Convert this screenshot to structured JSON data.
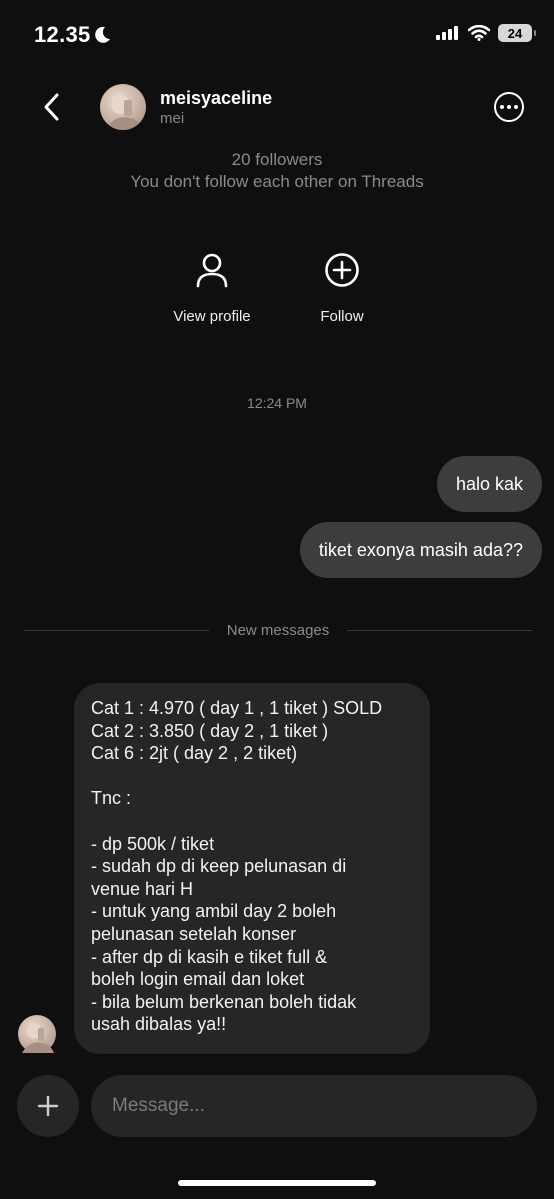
{
  "status_bar": {
    "time": "12.35",
    "battery": "24"
  },
  "header": {
    "username": "meisyaceline",
    "subname": "mei"
  },
  "profile_info": {
    "followers": "20 followers",
    "mutual": "You don't follow each other on Threads"
  },
  "actions": {
    "view_profile": "View profile",
    "follow": "Follow"
  },
  "timestamp": "12:24 PM",
  "outgoing": [
    "halo kak",
    "tiket exonya masih ada??"
  ],
  "divider": "New messages",
  "incoming_lines": [
    "Cat 1 : 4.970 ( day 1 , 1 tiket ) SOLD",
    "Cat 2 : 3.850 ( day 2 , 1 tiket )",
    "Cat 6 : 2jt ( day 2 , 2 tiket)",
    "",
    "Tnc :",
    "",
    "- dp 500k / tiket",
    "- sudah dp di keep pelunasan di",
    "venue hari H",
    "- untuk yang ambil day 2 boleh",
    "pelunasan setelah konser",
    "- after dp di kasih e tiket full &",
    "boleh login email dan loket",
    "- bila belum berkenan boleh tidak",
    "usah dibalas ya!!"
  ],
  "composer": {
    "placeholder": "Message..."
  }
}
